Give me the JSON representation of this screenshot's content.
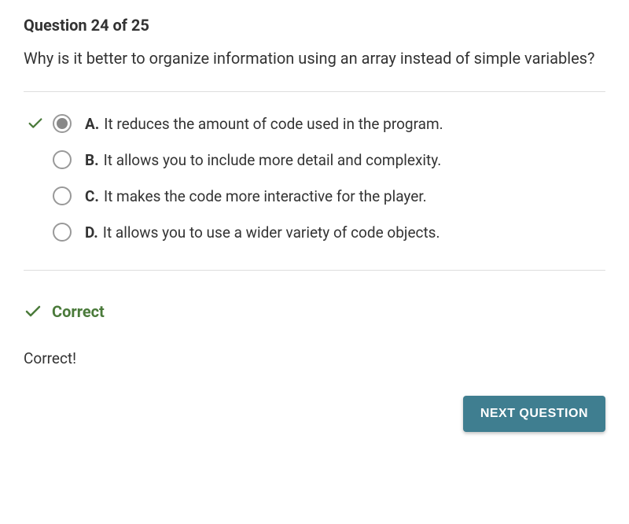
{
  "question": {
    "header": "Question 24 of 25",
    "text": "Why is it better to organize information using an array instead of simple variables?"
  },
  "choices": [
    {
      "letter": "A.",
      "text": "It reduces the amount of code used in the program.",
      "selected": true,
      "correct": true
    },
    {
      "letter": "B.",
      "text": "It allows you to include more detail and complexity.",
      "selected": false,
      "correct": false
    },
    {
      "letter": "C.",
      "text": "It makes the code more interactive for the player.",
      "selected": false,
      "correct": false
    },
    {
      "letter": "D.",
      "text": "It allows you to use a wider variety of code objects.",
      "selected": false,
      "correct": false
    }
  ],
  "feedback": {
    "heading": "Correct",
    "message": "Correct!"
  },
  "buttons": {
    "next": "NEXT QUESTION"
  },
  "colors": {
    "correct_green": "#4a7a3a",
    "button_bg": "#3f7e90"
  }
}
